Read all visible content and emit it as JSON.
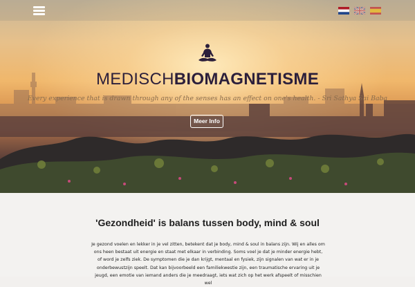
{
  "header": {
    "menu_icon": "hamburger-menu-icon",
    "languages": [
      {
        "code": "nl",
        "icon": "dutch-flag-icon"
      },
      {
        "code": "en",
        "icon": "uk-flag-icon"
      },
      {
        "code": "es",
        "icon": "spanish-flag-icon"
      }
    ]
  },
  "hero": {
    "logo_icon": "meditating-person-icon",
    "brand_light": "MEDISCH",
    "brand_bold": "BIOMAGNETISME",
    "quote": "Every experience that is drawn through any of the senses has an effect on one's health. - Sri Sathya Sai Baba",
    "button_label": "Meer Info"
  },
  "content": {
    "title": "'Gezondheid' is balans tussen body, mind & soul",
    "body": "Je gezond voelen en lekker in je vel zitten, betekent dat je body, mind & soul in balans zijn. Wij en alles om ons heen bestaat uit energie en staat met elkaar in verbinding. Soms voel je dat je minder energie hebt, of word je zelfs ziek. De symptomen die je dan krijgt, mentaal en fysiek, zijn signalen van wat er in je onderbewustzijn speelt. Dat kan bijvoorbeeld een familiekwestie zijn, een traumatische ervaring uit je jeugd, een emotie van iemand anders die je meedraagt, iets wat zich op het werk afspeelt of misschien wel"
  },
  "colors": {
    "brand_text": "#2c1f3b",
    "quote_text": "#8a6d4e",
    "page_background": "#f3f2f0"
  }
}
